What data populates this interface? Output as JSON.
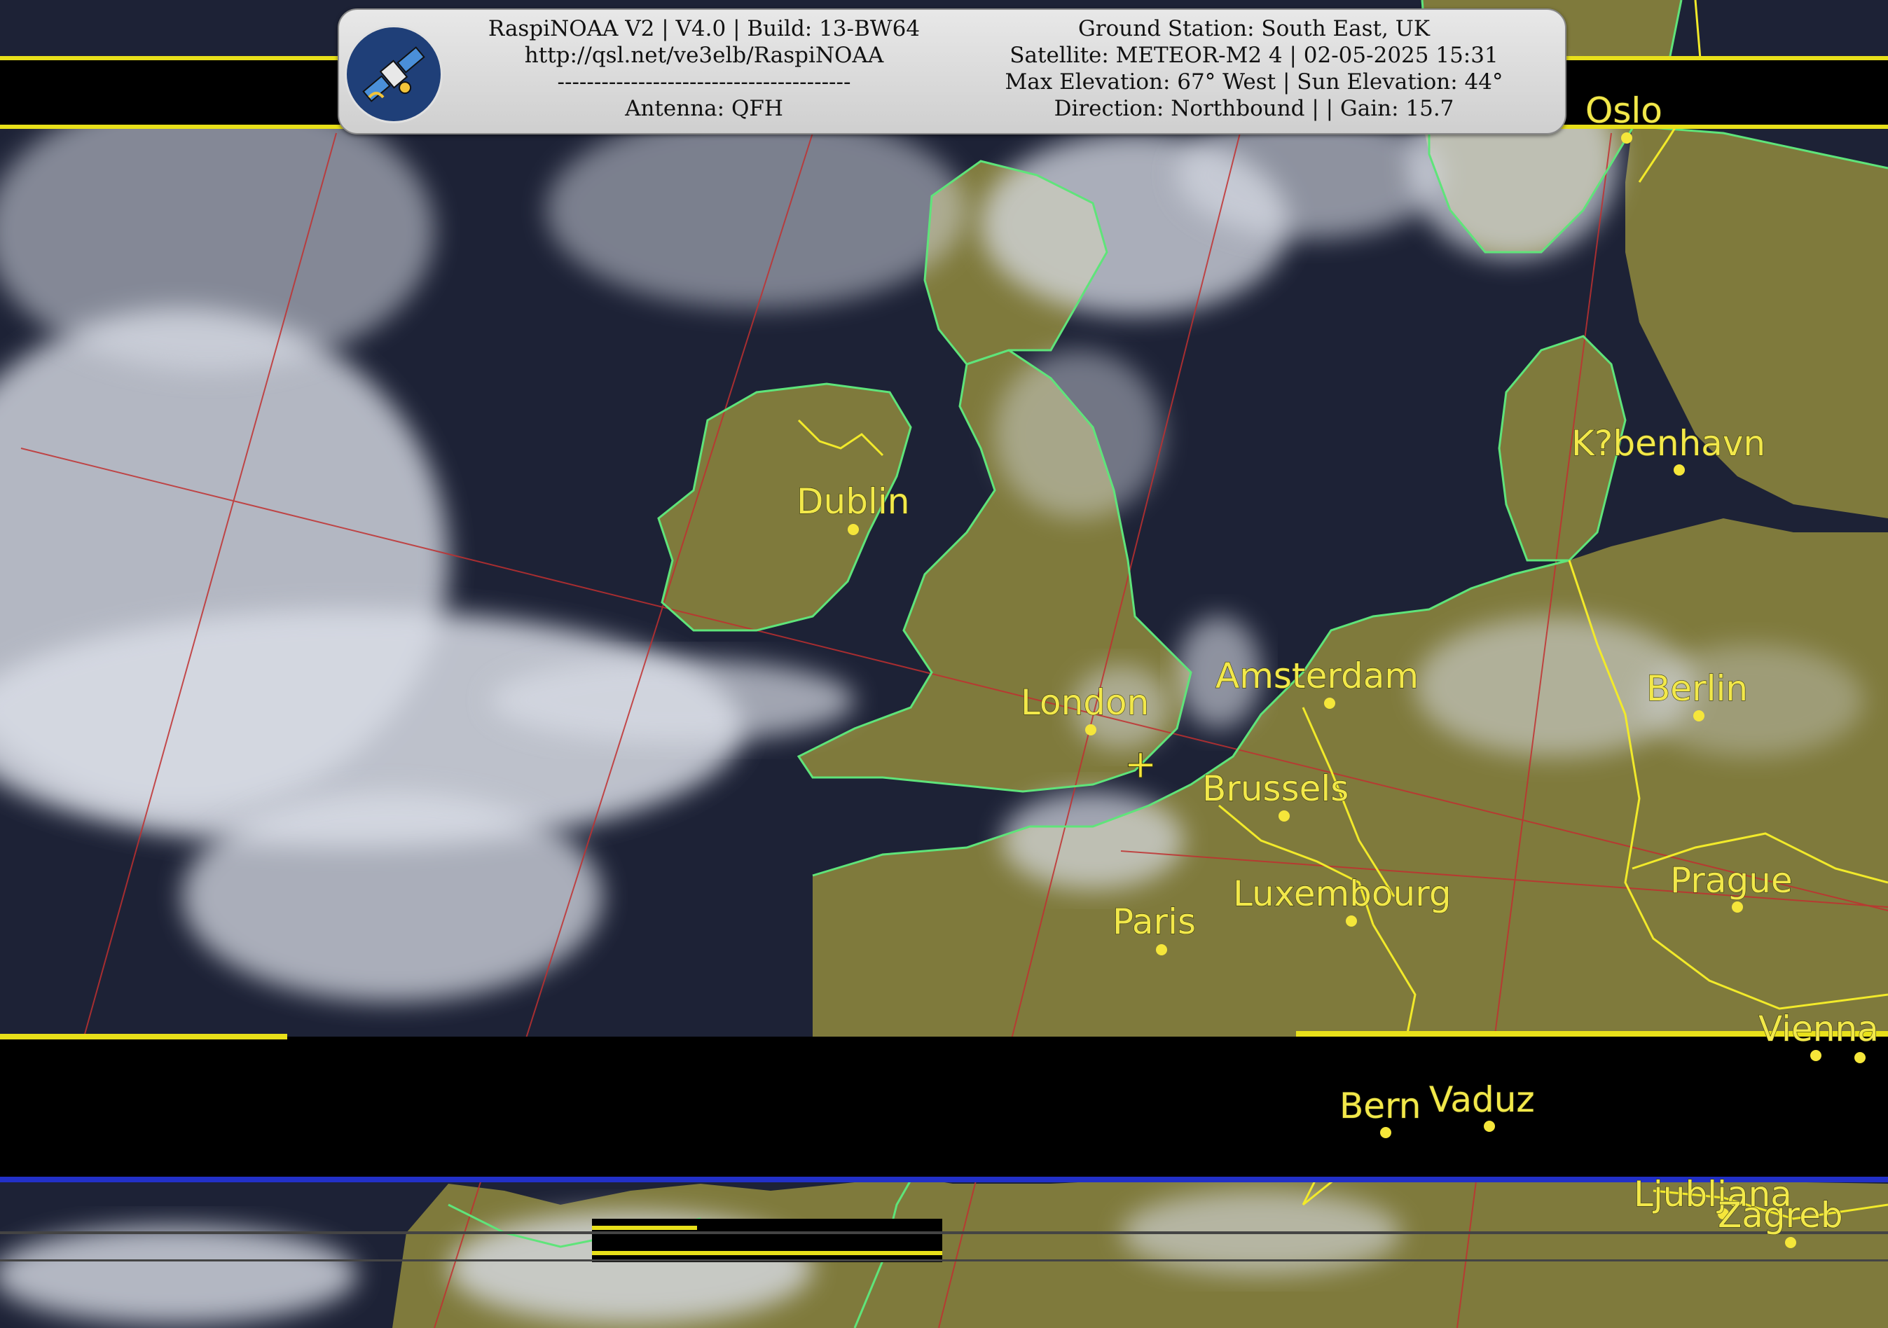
{
  "header": {
    "left_lines": [
      "RaspiNOAA V2 | V4.0 | Build: 13-BW64",
      "http://qsl.net/ve3elb/RaspiNOAA",
      "----------------------------------------",
      "Antenna: QFH"
    ],
    "right_lines": [
      "Ground Station: South East, UK",
      "Satellite: METEOR-M2 4 | 02-05-2025 15:31",
      "Max Elevation: 67° West | Sun Elevation: 44°",
      "Direction: Northbound | | Gain: 15.7"
    ],
    "logo_icon": "satellite-icon"
  },
  "cities": [
    {
      "name": "Oslo"
    },
    {
      "name": "K?benhavn"
    },
    {
      "name": "Dublin"
    },
    {
      "name": "Amsterdam"
    },
    {
      "name": "Berlin"
    },
    {
      "name": "London"
    },
    {
      "name": "Brussels"
    },
    {
      "name": "Prague"
    },
    {
      "name": "Luxembourg"
    },
    {
      "name": "Paris"
    },
    {
      "name": "Vienna"
    },
    {
      "name": "Bern"
    },
    {
      "name": "Vaduz"
    },
    {
      "name": "Ljubljana"
    },
    {
      "name": "Zagreb"
    }
  ],
  "ground_station_marker": "+",
  "colors": {
    "land": "#7f7a3c",
    "sea": "#1d2236",
    "cloud": "#d9dde6",
    "coastline": "#5fe47a",
    "border": "#f2ea2a",
    "label": "#f2e84a",
    "grid": "#c03030"
  }
}
